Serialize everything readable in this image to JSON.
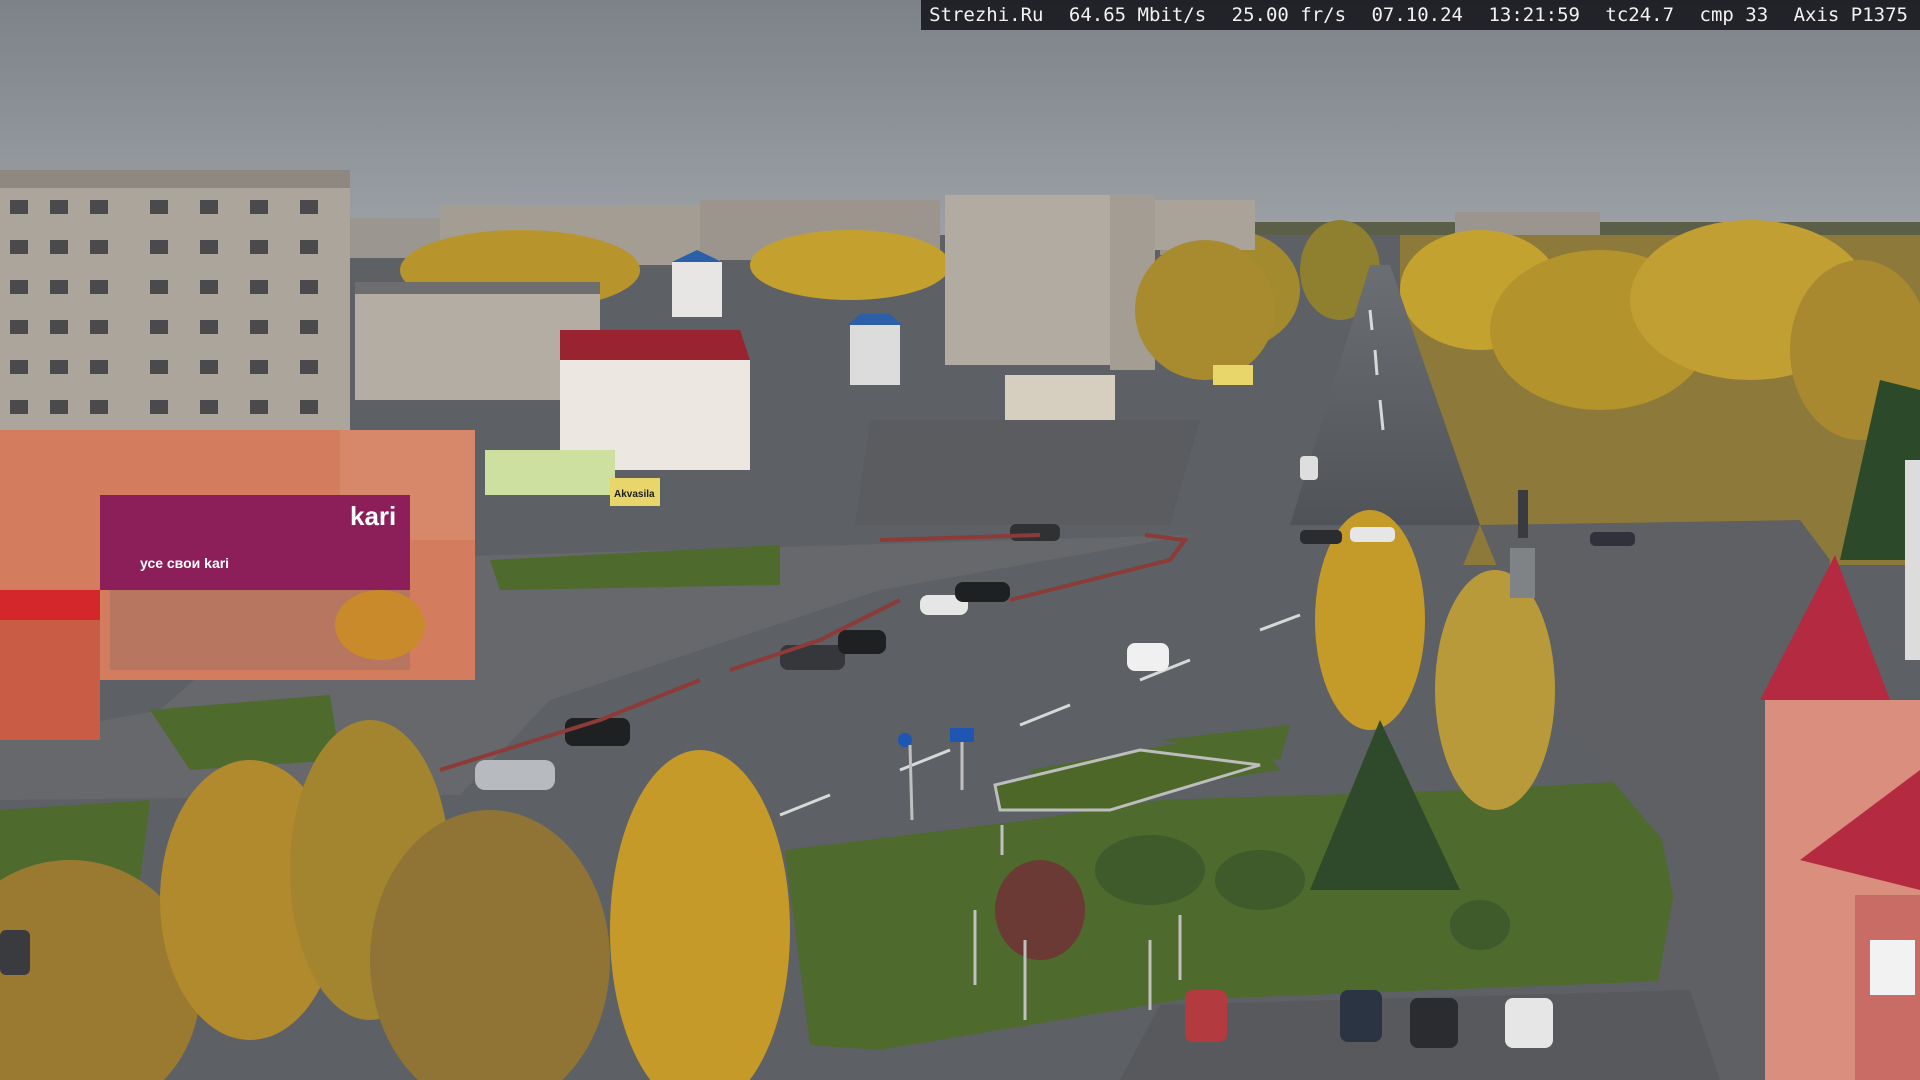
{
  "overlay": {
    "site": "Strezhi.Ru",
    "bitrate": "64.65 Mbit/s",
    "framerate": "25.00 fr/s",
    "date": "07.10.24",
    "time": "13:21:59",
    "tc": "tc24.7",
    "cmp": "cmp 33",
    "camera_model": "Axis P1375"
  },
  "signs": {
    "store_brand": "kari",
    "store_tagline": "усе свои kari",
    "store_banner": "Akvasila"
  },
  "colors": {
    "sky": "#8a8f96",
    "autumn_foliage": "#c9a22e",
    "store_magenta": "#8c1e5a",
    "roof_red": "#a8283c",
    "grass": "#4e6a2c",
    "asphalt": "#55585c"
  }
}
